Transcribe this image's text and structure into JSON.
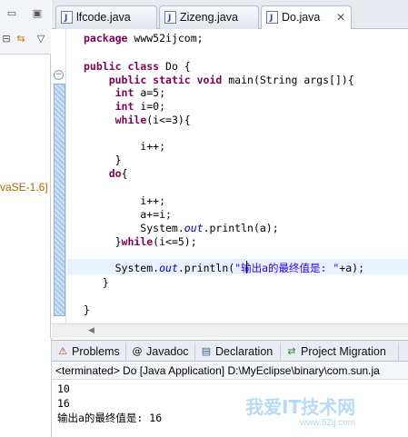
{
  "left_pane": {
    "toolbar_icons": [
      "collapse-all-icon",
      "link-editor-icon",
      "view-menu-icon"
    ],
    "library_label": "vaSE-1.6]"
  },
  "tabs": [
    {
      "label": "lfcode.java",
      "active": false
    },
    {
      "label": "Zizeng.java",
      "active": false
    },
    {
      "label": "Do.java",
      "active": true,
      "close": "✕"
    }
  ],
  "code_lines": [
    "package www52ijcom;",
    "",
    "public class Do {",
    "    public static void main(String args[]){",
    "     int a=5;",
    "     int i=0;",
    "     while(i<=3){",
    "",
    "         i++;",
    "     }",
    "    do{",
    "",
    "         i++;",
    "         a+=i;",
    "         System.out.println(a);",
    "     }while(i<=5);",
    "",
    "     System.out.println(\"输出a的最终值是: \"+a);",
    "   }",
    "",
    "}"
  ],
  "views": [
    {
      "label": "Problems",
      "icon": "problems-icon"
    },
    {
      "label": "Javadoc",
      "icon": "at-icon"
    },
    {
      "label": "Declaration",
      "icon": "declaration-icon"
    },
    {
      "label": "Project Migration",
      "icon": "migration-icon"
    }
  ],
  "console": {
    "header": "<terminated> Do [Java Application] D:\\MyEclipse\\binary\\com.sun.ja",
    "output": [
      "10",
      "16",
      "输出a的最终值是: 16"
    ]
  },
  "watermark": {
    "text": "我爱IT技术网",
    "url": "www.52ij.com"
  }
}
